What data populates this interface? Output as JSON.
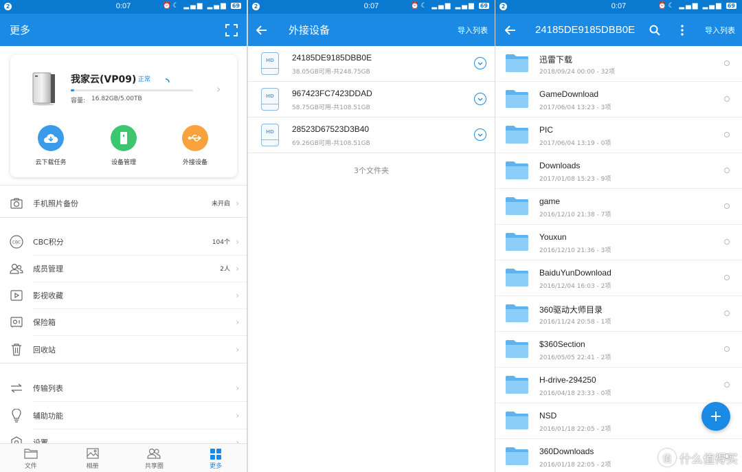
{
  "status_bar": {
    "time": "0:07",
    "notif_count": "2",
    "battery": "69"
  },
  "panel_more": {
    "title": "更多",
    "device": {
      "name": "我家云(VP09)",
      "status": "正常",
      "capacity_label": "容量:",
      "capacity_value": "16.82GB/5.00TB",
      "usage_fraction": 0.0034
    },
    "features": [
      {
        "label": "云下载任务",
        "icon": "cloud-download-icon",
        "color": "#3a9bea"
      },
      {
        "label": "设备管理",
        "icon": "device-icon",
        "color": "#3cc66f"
      },
      {
        "label": "外接设备",
        "icon": "usb-icon",
        "color": "#f7a23a"
      }
    ],
    "menu": [
      {
        "label": "手机照片备份",
        "value": "未开启",
        "icon": "camera-icon"
      },
      {
        "label": "CBC积分",
        "value": "104个",
        "icon": "cbc-icon"
      },
      {
        "label": "成员管理",
        "value": "2人",
        "icon": "members-icon"
      },
      {
        "label": "影视收藏",
        "value": "",
        "icon": "video-icon"
      },
      {
        "label": "保险箱",
        "value": "",
        "icon": "safe-icon"
      },
      {
        "label": "回收站",
        "value": "",
        "icon": "trash-icon"
      },
      {
        "label": "传输列表",
        "value": "",
        "icon": "transfer-icon"
      },
      {
        "label": "辅助功能",
        "value": "",
        "icon": "bulb-icon"
      },
      {
        "label": "设置",
        "value": "",
        "icon": "settings-icon"
      }
    ],
    "bottom_nav": [
      {
        "label": "文件",
        "icon": "folder-icon",
        "active": false
      },
      {
        "label": "相册",
        "icon": "album-icon",
        "active": false
      },
      {
        "label": "共享圈",
        "icon": "share-circle-icon",
        "active": false
      },
      {
        "label": "更多",
        "icon": "grid-icon",
        "active": true
      }
    ]
  },
  "panel_external": {
    "title": "外接设备",
    "import_label": "导入列表",
    "drives": [
      {
        "name": "24185DE9185DBB0E",
        "space": "38.05GB可用-共248.75GB",
        "icon_text": "HD"
      },
      {
        "name": "967423FC7423DDAD",
        "space": "58.75GB可用-共108.51GB",
        "icon_text": "HD"
      },
      {
        "name": "28523D67523D3B40",
        "space": "69.26GB可用-共108.51GB",
        "icon_text": "HD"
      }
    ],
    "folder_count": "3个文件夹"
  },
  "panel_drive": {
    "title": "24185DE9185DBB0E",
    "import_label": "导入列表",
    "folders": [
      {
        "name": "迅雷下载",
        "meta": "2018/09/24 00:00 - 32项"
      },
      {
        "name": "GameDownload",
        "meta": "2017/06/04 13:23 - 3项"
      },
      {
        "name": "PIC",
        "meta": "2017/06/04 13:19 - 0项"
      },
      {
        "name": "Downloads",
        "meta": "2017/01/08 15:23 - 9项"
      },
      {
        "name": "game",
        "meta": "2016/12/10 21:38 - 7项"
      },
      {
        "name": "Youxun",
        "meta": "2016/12/10 21:36 - 3项"
      },
      {
        "name": "BaiduYunDownload",
        "meta": "2016/12/04 16:03 - 2项"
      },
      {
        "name": "360驱动大师目录",
        "meta": "2016/11/24 20:58 - 1项"
      },
      {
        "name": "$360Section",
        "meta": "2016/05/05 22:41 - 2项"
      },
      {
        "name": "H-drive-294250",
        "meta": "2016/04/18 23:33 - 0项"
      },
      {
        "name": "NSD",
        "meta": "2016/01/18 22:05 - 2项"
      },
      {
        "name": "360Downloads",
        "meta": "2016/01/18 22:05 - 2项"
      }
    ],
    "fab_label": "+"
  },
  "watermark": {
    "text": "什么值得买",
    "mark": "值"
  },
  "colors": {
    "primary": "#1a8ae5",
    "statusbar": "#0a7ad0",
    "folder": "#7cc4f5"
  }
}
